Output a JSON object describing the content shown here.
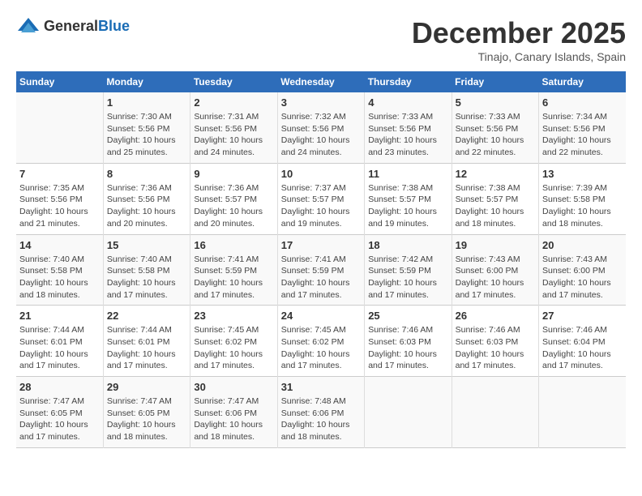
{
  "logo": {
    "general": "General",
    "blue": "Blue"
  },
  "title": "December 2025",
  "subtitle": "Tinajo, Canary Islands, Spain",
  "headers": [
    "Sunday",
    "Monday",
    "Tuesday",
    "Wednesday",
    "Thursday",
    "Friday",
    "Saturday"
  ],
  "weeks": [
    [
      {
        "day": "",
        "info": ""
      },
      {
        "day": "1",
        "info": "Sunrise: 7:30 AM\nSunset: 5:56 PM\nDaylight: 10 hours and 25 minutes."
      },
      {
        "day": "2",
        "info": "Sunrise: 7:31 AM\nSunset: 5:56 PM\nDaylight: 10 hours and 24 minutes."
      },
      {
        "day": "3",
        "info": "Sunrise: 7:32 AM\nSunset: 5:56 PM\nDaylight: 10 hours and 24 minutes."
      },
      {
        "day": "4",
        "info": "Sunrise: 7:33 AM\nSunset: 5:56 PM\nDaylight: 10 hours and 23 minutes."
      },
      {
        "day": "5",
        "info": "Sunrise: 7:33 AM\nSunset: 5:56 PM\nDaylight: 10 hours and 22 minutes."
      },
      {
        "day": "6",
        "info": "Sunrise: 7:34 AM\nSunset: 5:56 PM\nDaylight: 10 hours and 22 minutes."
      }
    ],
    [
      {
        "day": "7",
        "info": "Sunrise: 7:35 AM\nSunset: 5:56 PM\nDaylight: 10 hours and 21 minutes."
      },
      {
        "day": "8",
        "info": "Sunrise: 7:36 AM\nSunset: 5:56 PM\nDaylight: 10 hours and 20 minutes."
      },
      {
        "day": "9",
        "info": "Sunrise: 7:36 AM\nSunset: 5:57 PM\nDaylight: 10 hours and 20 minutes."
      },
      {
        "day": "10",
        "info": "Sunrise: 7:37 AM\nSunset: 5:57 PM\nDaylight: 10 hours and 19 minutes."
      },
      {
        "day": "11",
        "info": "Sunrise: 7:38 AM\nSunset: 5:57 PM\nDaylight: 10 hours and 19 minutes."
      },
      {
        "day": "12",
        "info": "Sunrise: 7:38 AM\nSunset: 5:57 PM\nDaylight: 10 hours and 18 minutes."
      },
      {
        "day": "13",
        "info": "Sunrise: 7:39 AM\nSunset: 5:58 PM\nDaylight: 10 hours and 18 minutes."
      }
    ],
    [
      {
        "day": "14",
        "info": "Sunrise: 7:40 AM\nSunset: 5:58 PM\nDaylight: 10 hours and 18 minutes."
      },
      {
        "day": "15",
        "info": "Sunrise: 7:40 AM\nSunset: 5:58 PM\nDaylight: 10 hours and 17 minutes."
      },
      {
        "day": "16",
        "info": "Sunrise: 7:41 AM\nSunset: 5:59 PM\nDaylight: 10 hours and 17 minutes."
      },
      {
        "day": "17",
        "info": "Sunrise: 7:41 AM\nSunset: 5:59 PM\nDaylight: 10 hours and 17 minutes."
      },
      {
        "day": "18",
        "info": "Sunrise: 7:42 AM\nSunset: 5:59 PM\nDaylight: 10 hours and 17 minutes."
      },
      {
        "day": "19",
        "info": "Sunrise: 7:43 AM\nSunset: 6:00 PM\nDaylight: 10 hours and 17 minutes."
      },
      {
        "day": "20",
        "info": "Sunrise: 7:43 AM\nSunset: 6:00 PM\nDaylight: 10 hours and 17 minutes."
      }
    ],
    [
      {
        "day": "21",
        "info": "Sunrise: 7:44 AM\nSunset: 6:01 PM\nDaylight: 10 hours and 17 minutes."
      },
      {
        "day": "22",
        "info": "Sunrise: 7:44 AM\nSunset: 6:01 PM\nDaylight: 10 hours and 17 minutes."
      },
      {
        "day": "23",
        "info": "Sunrise: 7:45 AM\nSunset: 6:02 PM\nDaylight: 10 hours and 17 minutes."
      },
      {
        "day": "24",
        "info": "Sunrise: 7:45 AM\nSunset: 6:02 PM\nDaylight: 10 hours and 17 minutes."
      },
      {
        "day": "25",
        "info": "Sunrise: 7:46 AM\nSunset: 6:03 PM\nDaylight: 10 hours and 17 minutes."
      },
      {
        "day": "26",
        "info": "Sunrise: 7:46 AM\nSunset: 6:03 PM\nDaylight: 10 hours and 17 minutes."
      },
      {
        "day": "27",
        "info": "Sunrise: 7:46 AM\nSunset: 6:04 PM\nDaylight: 10 hours and 17 minutes."
      }
    ],
    [
      {
        "day": "28",
        "info": "Sunrise: 7:47 AM\nSunset: 6:05 PM\nDaylight: 10 hours and 17 minutes."
      },
      {
        "day": "29",
        "info": "Sunrise: 7:47 AM\nSunset: 6:05 PM\nDaylight: 10 hours and 18 minutes."
      },
      {
        "day": "30",
        "info": "Sunrise: 7:47 AM\nSunset: 6:06 PM\nDaylight: 10 hours and 18 minutes."
      },
      {
        "day": "31",
        "info": "Sunrise: 7:48 AM\nSunset: 6:06 PM\nDaylight: 10 hours and 18 minutes."
      },
      {
        "day": "",
        "info": ""
      },
      {
        "day": "",
        "info": ""
      },
      {
        "day": "",
        "info": ""
      }
    ]
  ]
}
